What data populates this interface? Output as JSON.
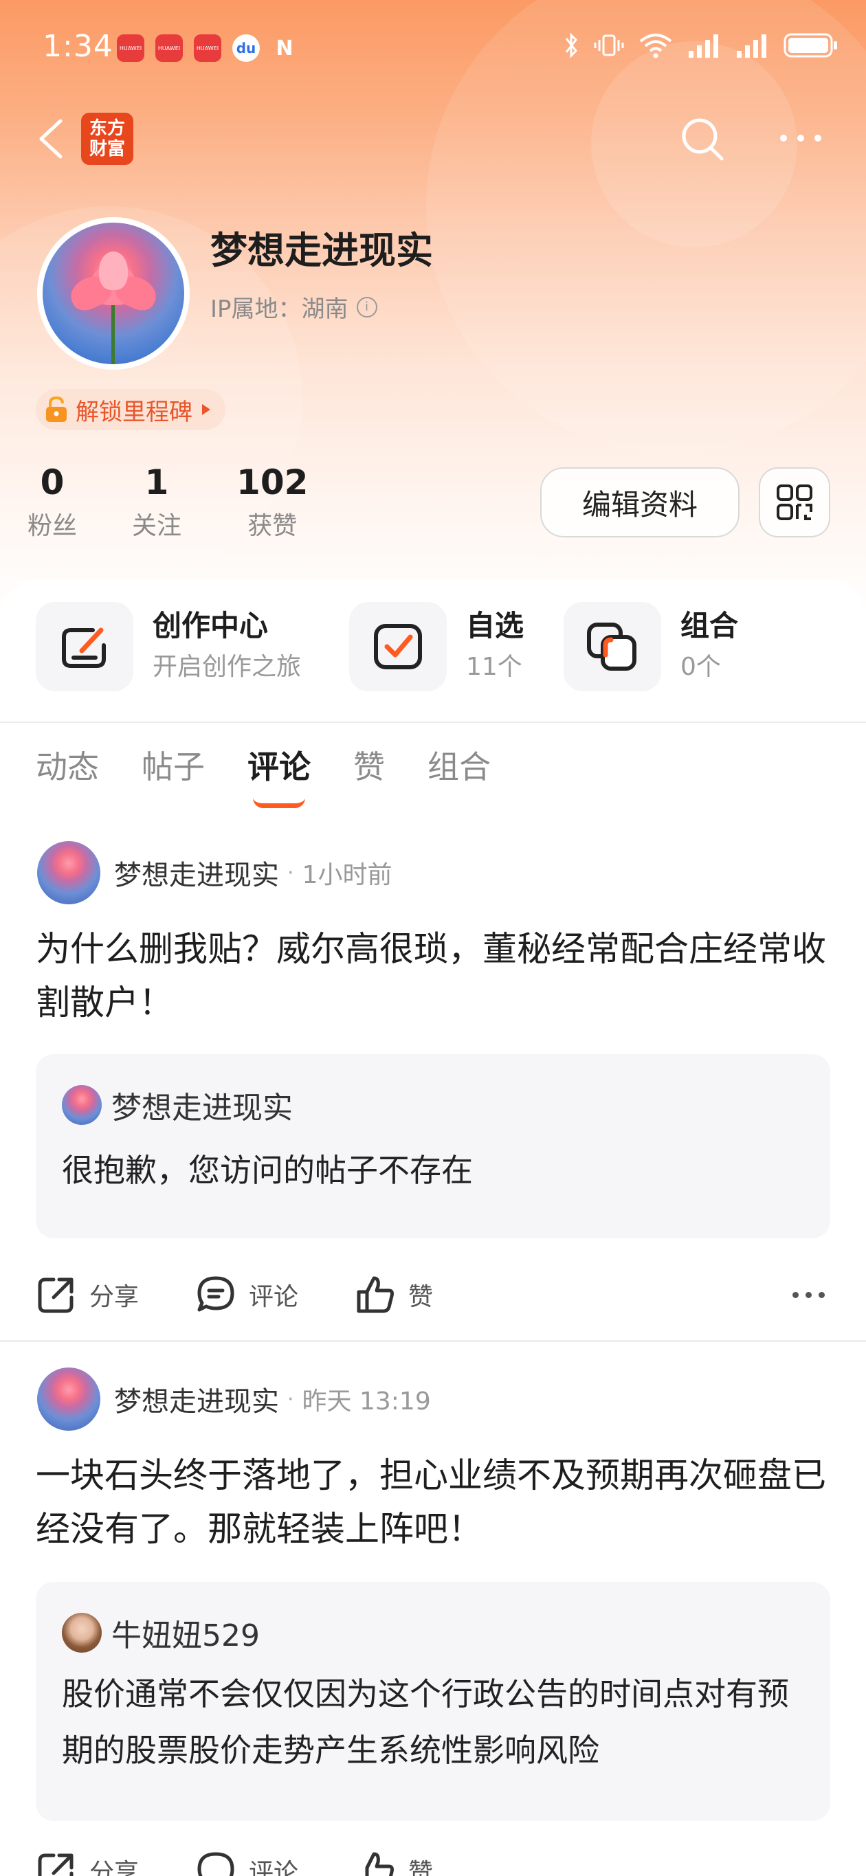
{
  "status_bar": {
    "time": "1:34",
    "notifications": [
      "HUAWEI",
      "HUAWEI",
      "HUAWEI"
    ],
    "baidu_icon": "baidu-icon",
    "nfc_label": "N"
  },
  "nav": {
    "app_logo_line1": "东方",
    "app_logo_line2": "财富",
    "accent_color": "#e8461d"
  },
  "profile": {
    "username": "梦想走进现实",
    "ip_location": "IP属地：湖南",
    "milestone_label": "解锁里程碑",
    "stats": [
      {
        "num": "0",
        "label": "粉丝"
      },
      {
        "num": "1",
        "label": "关注"
      },
      {
        "num": "102",
        "label": "获赞"
      }
    ],
    "edit_label": "编辑资料"
  },
  "features": [
    {
      "title": "创作中心",
      "subtitle": "开启创作之旅"
    },
    {
      "title": "自选",
      "subtitle": "11个"
    },
    {
      "title": "组合",
      "subtitle": "0个"
    }
  ],
  "tabs": [
    "动态",
    "帖子",
    "评论",
    "赞",
    "组合"
  ],
  "active_tab": "评论",
  "posts": [
    {
      "author": "梦想走进现实",
      "time": "1小时前",
      "body": "为什么删我贴？威尔高很琐，董秘经常配合庄经常收割散户！",
      "quote_author": "梦想走进现实",
      "quote_text": "很抱歉，您访问的帖子不存在"
    },
    {
      "author": "梦想走进现实",
      "time": "昨天 13:19",
      "body": "一块石头终于落地了，担心业绩不及预期再次砸盘已经没有了。那就轻装上阵吧！",
      "quote_author": "牛妞妞529",
      "quote_text": "股价通常不会仅仅因为这个行政公告的时间点对有预期的股票股价走势产生系统性影响风险"
    }
  ],
  "actions": {
    "share": "分享",
    "comment": "评论",
    "like": "赞"
  }
}
